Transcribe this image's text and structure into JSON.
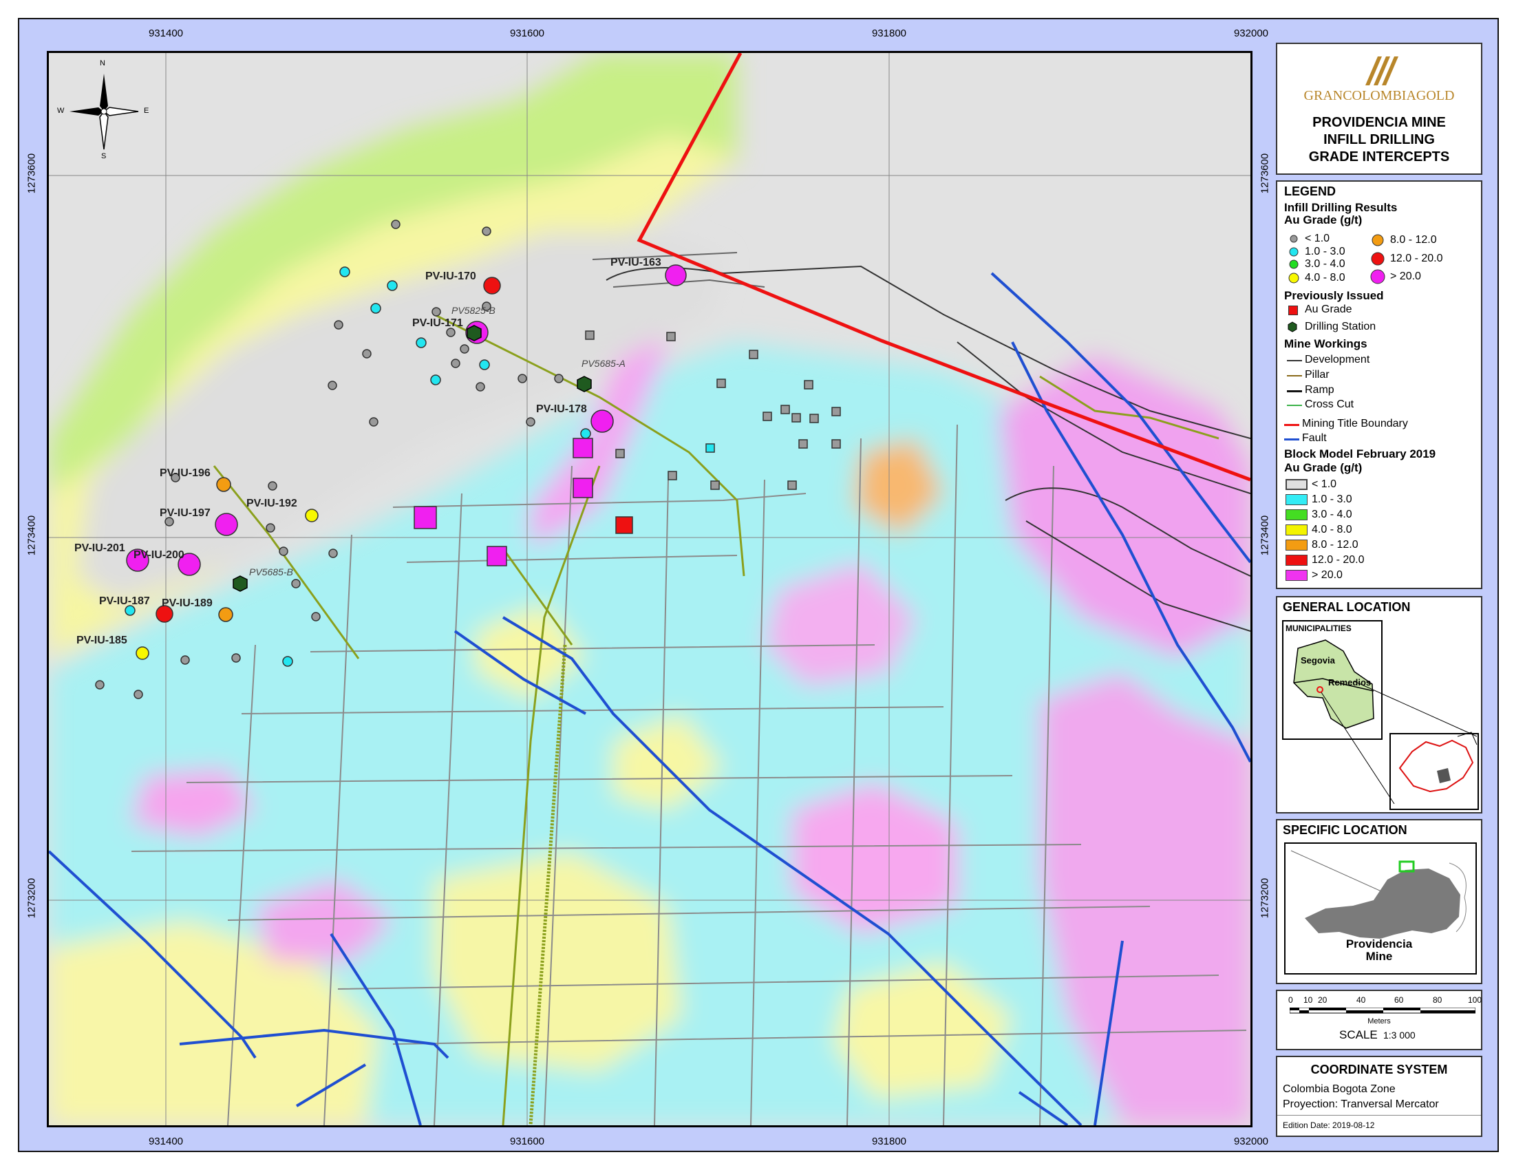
{
  "map": {
    "x_ticks": [
      "931400",
      "931600",
      "931800",
      "932000"
    ],
    "y_ticks": [
      "1273600",
      "1273400",
      "1273200"
    ],
    "north_arrow": {
      "n": "N",
      "s": "S",
      "e": "E",
      "w": "W"
    },
    "drillholes": [
      "PV-IU-170",
      "PV-IU-163",
      "PV-IU-171",
      "PV-IU-178",
      "PV-IU-196",
      "PV-IU-192",
      "PV-IU-197",
      "PV-IU-201",
      "PV-IU-200",
      "PV-IU-187",
      "PV-IU-189",
      "PV-IU-185"
    ],
    "stations": [
      "PV5825-B",
      "PV5685-A",
      "PV5685-B"
    ]
  },
  "title_panel": {
    "logo_text": "GRANCOLOMBIAGOLD",
    "title_lines": [
      "PROVIDENCIA MINE",
      "INFILL DRILLING",
      "GRADE INTERCEPTS"
    ]
  },
  "legend": {
    "heading": "LEGEND",
    "infill_heading": "Infill Drilling Results",
    "au_heading": "Au Grade (g/t)",
    "grades": [
      {
        "label": "< 1.0",
        "color": "#9a9a9a"
      },
      {
        "label": "1.0 - 3.0",
        "color": "#22e6f0"
      },
      {
        "label": "3.0 - 4.0",
        "color": "#22dd22"
      },
      {
        "label": "4.0 - 8.0",
        "color": "#f8f800"
      },
      {
        "label": "8.0 - 12.0",
        "color": "#f39c12"
      },
      {
        "label": "12.0 - 20.0",
        "color": "#ee1111"
      },
      {
        "label": "> 20.0",
        "color": "#f020f0"
      }
    ],
    "prev_heading": "Previously Issued",
    "prev_items": [
      "Au Grade",
      "Drilling Station"
    ],
    "workings_heading": "Mine Workings",
    "workings": [
      {
        "label": "Development",
        "color": "#333333"
      },
      {
        "label": "Pillar",
        "color": "#8a6a1a"
      },
      {
        "label": "Ramp",
        "color": "#111111"
      },
      {
        "label": "Cross Cut",
        "color": "#3cb34a"
      }
    ],
    "boundary_label": "Mining Title Boundary",
    "fault_label": "Fault",
    "block_heading": "Block Model February 2019",
    "block_au_heading": "Au Grade (g/t)",
    "block_grades": [
      {
        "label": "< 1.0",
        "color": "#e0e0e0"
      },
      {
        "label": "1.0 - 3.0",
        "color": "#33ecf5"
      },
      {
        "label": "3.0 - 4.0",
        "color": "#44dd22"
      },
      {
        "label": "4.0 - 8.0",
        "color": "#f4f400"
      },
      {
        "label": "8.0 - 12.0",
        "color": "#f39c12"
      },
      {
        "label": "12.0 - 20.0",
        "color": "#ee1111"
      },
      {
        "label": "> 20.0",
        "color": "#f033f0"
      }
    ]
  },
  "general_location": {
    "heading": "GENERAL LOCATION",
    "municipalities": "MUNICIPALITIES",
    "segovia": "Segovia",
    "remedios": "Remedios"
  },
  "specific_location": {
    "heading": "SPECIFIC LOCATION",
    "label_line1": "Providencia",
    "label_line2": "Mine"
  },
  "scale": {
    "ticks": [
      "0",
      "10",
      "20",
      "40",
      "60",
      "80",
      "100"
    ],
    "unit": "Meters",
    "label": "SCALE",
    "ratio": "1:3 000"
  },
  "coordinate_system": {
    "heading": "COORDINATE SYSTEM",
    "zone": "Colombia Bogota Zone",
    "projection": "Proyection: Tranversal Mercator",
    "edition": "Edition Date: 2019-08-12"
  }
}
